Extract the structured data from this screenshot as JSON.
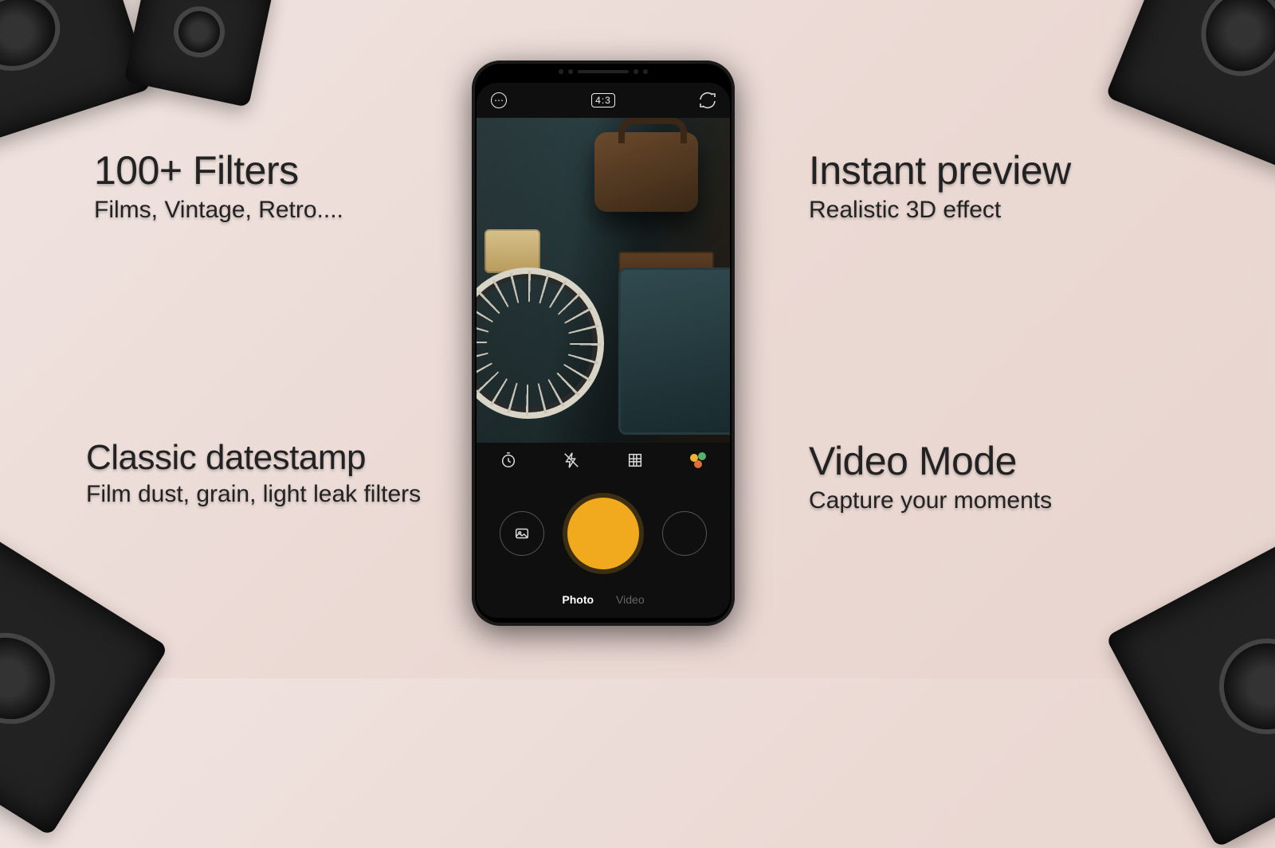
{
  "features": {
    "top_left": {
      "title": "100+ Filters",
      "subtitle": "Films, Vintage, Retro...."
    },
    "bottom_left": {
      "title": "Classic datestamp",
      "subtitle": "Film dust, grain, light leak filters"
    },
    "top_right": {
      "title": "Instant preview",
      "subtitle": "Realistic 3D effect"
    },
    "bottom_right": {
      "title": "Video Mode",
      "subtitle": "Capture your moments"
    }
  },
  "app": {
    "aspect_ratio": "4:3",
    "flash_state": "off",
    "modes": {
      "photo": "Photo",
      "video": "Video",
      "active": "photo"
    },
    "icons": {
      "more": "more-icon",
      "switch": "camera-switch-icon",
      "timer": "timer-icon",
      "flash": "flash-off-icon",
      "grid": "grid-icon",
      "color": "color-filter-icon",
      "gallery": "gallery-icon",
      "shutter": "shutter-button",
      "filters": "filter-wheel-button"
    },
    "colors": {
      "accent": "#f1aa1e"
    }
  }
}
